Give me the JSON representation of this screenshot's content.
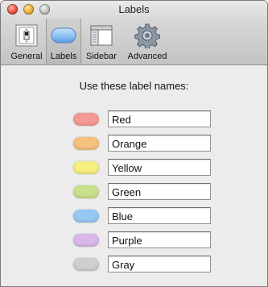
{
  "window": {
    "title": "Labels"
  },
  "toolbar": {
    "items": [
      {
        "label": "General",
        "icon": "light-switch-icon",
        "selected": false
      },
      {
        "label": "Labels",
        "icon": "label-pill-icon",
        "selected": true
      },
      {
        "label": "Sidebar",
        "icon": "sidebar-window-icon",
        "selected": false
      },
      {
        "label": "Advanced",
        "icon": "gear-icon",
        "selected": false
      }
    ]
  },
  "labels_pane": {
    "instruction": "Use these label names:",
    "labels": [
      {
        "name": "Red",
        "color": "#f39a96"
      },
      {
        "name": "Orange",
        "color": "#f8c07e"
      },
      {
        "name": "Yellow",
        "color": "#f6ee7f"
      },
      {
        "name": "Green",
        "color": "#c9e08c"
      },
      {
        "name": "Blue",
        "color": "#95c8f3"
      },
      {
        "name": "Purple",
        "color": "#d9b7ea"
      },
      {
        "name": "Gray",
        "color": "#cfcfcf"
      }
    ]
  }
}
